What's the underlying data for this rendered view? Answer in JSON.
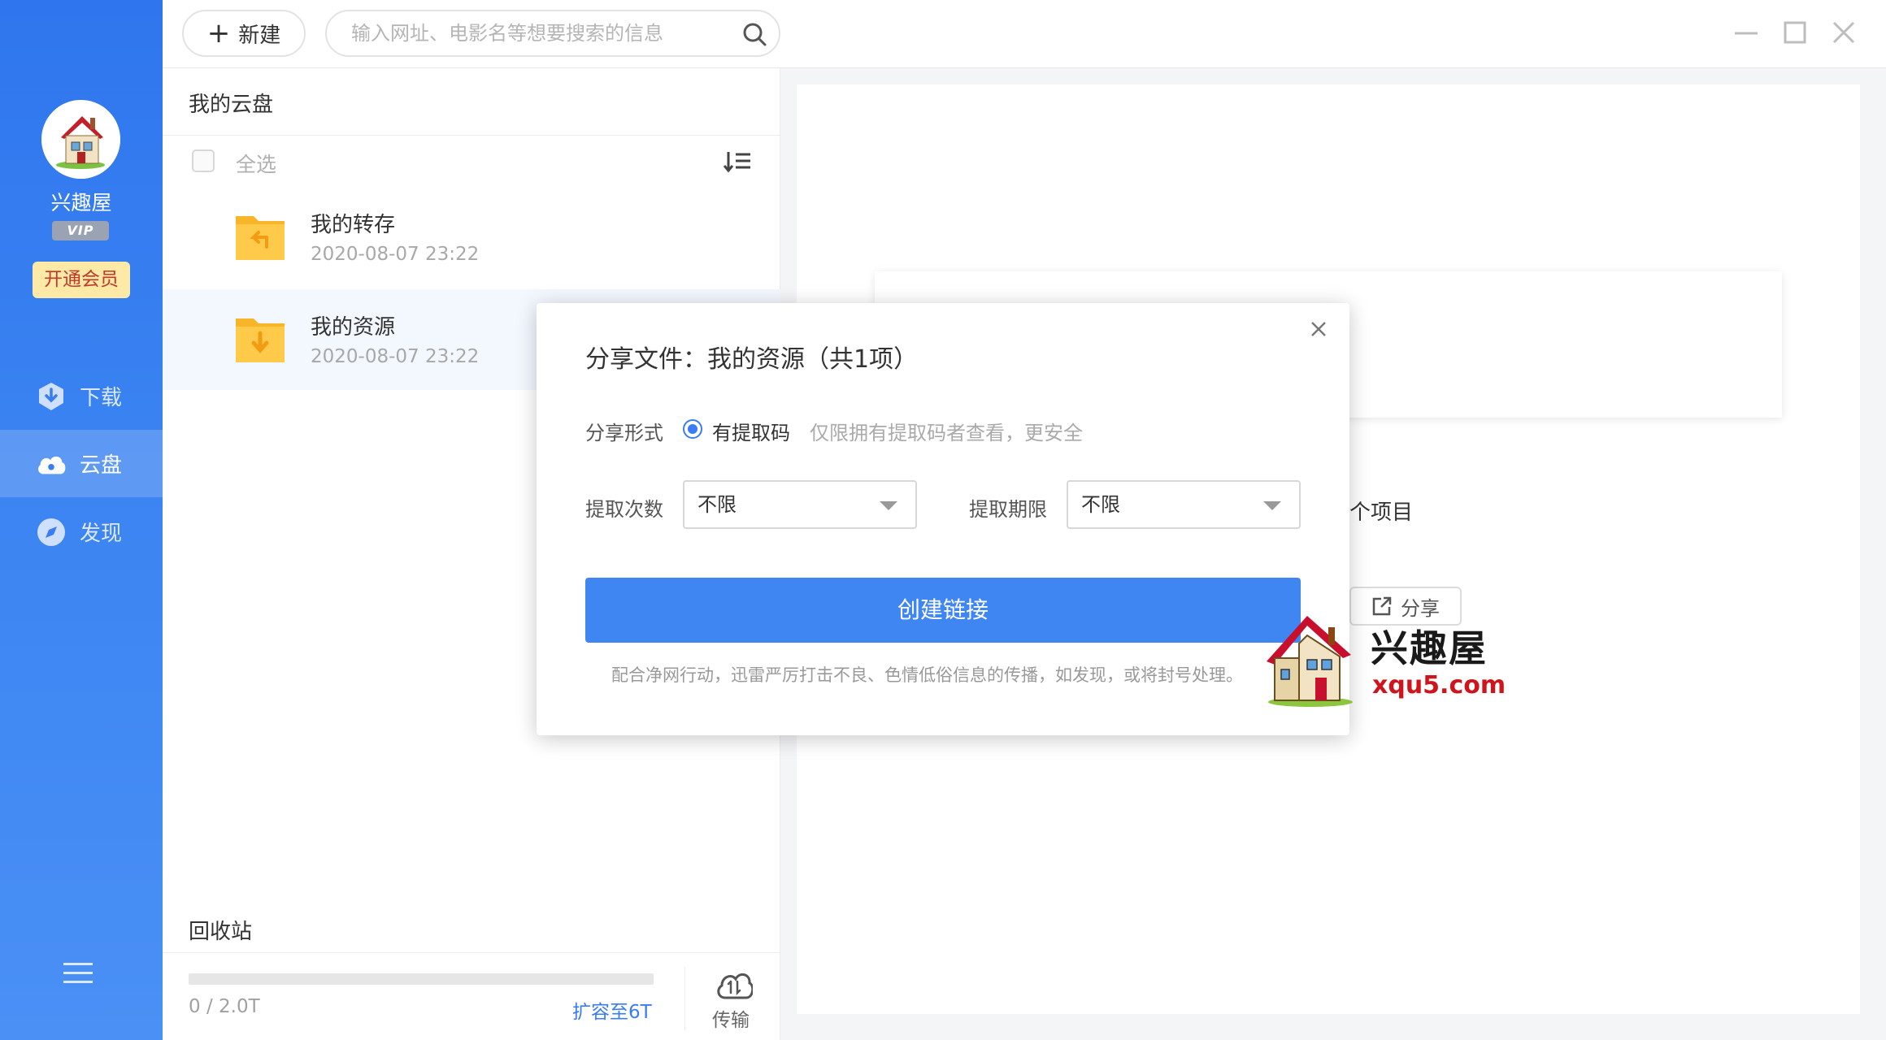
{
  "sidebar": {
    "username": "兴趣屋",
    "vip_badge": "VIP",
    "vip_button": "开通会员",
    "nav": [
      {
        "label": "下载",
        "icon": "download-shield-icon"
      },
      {
        "label": "云盘",
        "icon": "cloud-icon",
        "active": true
      },
      {
        "label": "发现",
        "icon": "compass-icon"
      }
    ],
    "menu_icon": "hamburger-menu-icon"
  },
  "topbar": {
    "new_label": "新建",
    "search_placeholder": "输入网址、电影名等想要搜索的信息"
  },
  "panel": {
    "title": "我的云盘",
    "select_all": "全选",
    "files": [
      {
        "name": "我的转存",
        "date": "2020-08-07 23:22",
        "icon": "folder-transfer-icon"
      },
      {
        "name": "我的资源",
        "date": "2020-08-07 23:22",
        "icon": "folder-download-icon",
        "selected": true
      }
    ],
    "recycle": "回收站",
    "storage_text": "0 / 2.0T",
    "storage_used_fraction": 0,
    "expand_link": "扩容至6T",
    "transfer_label": "传输"
  },
  "content": {
    "behind_text": "个项目",
    "share_button": "分享"
  },
  "modal": {
    "title": "分享文件：我的资源（共1项）",
    "share_form_label": "分享形式",
    "share_option": "有提取码",
    "share_hint": "仅限拥有提取码者查看，更安全",
    "count_label": "提取次数",
    "count_value": "不限",
    "period_label": "提取期限",
    "period_value": "不限",
    "create_button": "创建链接",
    "notice": "配合净网行动，迅雷严厉打击不良、色情低俗信息的传播，如发现，或将封号处理。"
  },
  "watermark": {
    "name": "兴趣屋",
    "url": "xqu5.com"
  },
  "colors": {
    "sidebar_top": "#2f76ee",
    "sidebar_bottom": "#4a90f5",
    "accent": "#3f86f3",
    "vip_button_bg": "#ffe9a6",
    "vip_button_text": "#c0392b"
  }
}
